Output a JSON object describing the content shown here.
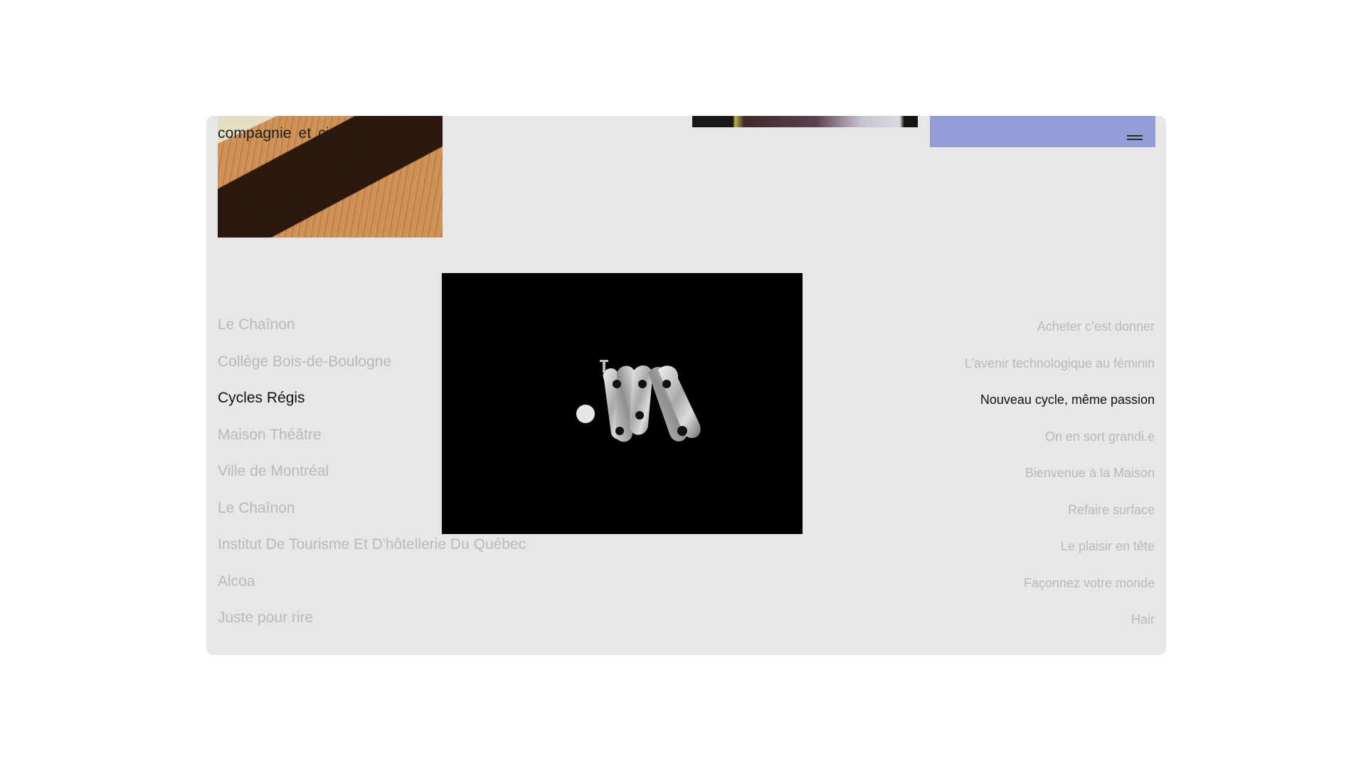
{
  "brand": {
    "name": "compagnie  et  cie"
  },
  "projects": [
    {
      "client": "Le Chaînon",
      "title": "Acheter c’est donner",
      "state": "inactive"
    },
    {
      "client": "Collège Bois-de-Boulogne",
      "title": "L’avenir technologique au féminin",
      "state": "inactive"
    },
    {
      "client": "Cycles Régis",
      "title": "Nouveau cycle, même passion",
      "state": "active"
    },
    {
      "client": "Maison Théâtre",
      "title": "On en sort grandi.e",
      "state": "inactive"
    },
    {
      "client": "Ville de Montréal",
      "title": "Bienvenue à la Maison",
      "state": "inactive"
    },
    {
      "client": "Le Chaînon",
      "title": "Refaire surface",
      "state": "inactive"
    },
    {
      "client": "Institut De Tourisme Et D'hôtellerie Du Québec",
      "title": "Le plaisir en tête",
      "state": "inactive"
    },
    {
      "client": "Alcoa",
      "title": "Façonnez votre monde",
      "state": "inactive"
    },
    {
      "client": "Juste pour rire",
      "title": "Hair",
      "state": "inactive"
    }
  ],
  "icons": {
    "menu": "hamburger-menu-icon"
  },
  "colors": {
    "background": "#e7e7e7",
    "active_text": "#111111",
    "inactive_text": "#b9b9b9",
    "accent_block": "#929ed5",
    "preview_bg": "#000000"
  }
}
